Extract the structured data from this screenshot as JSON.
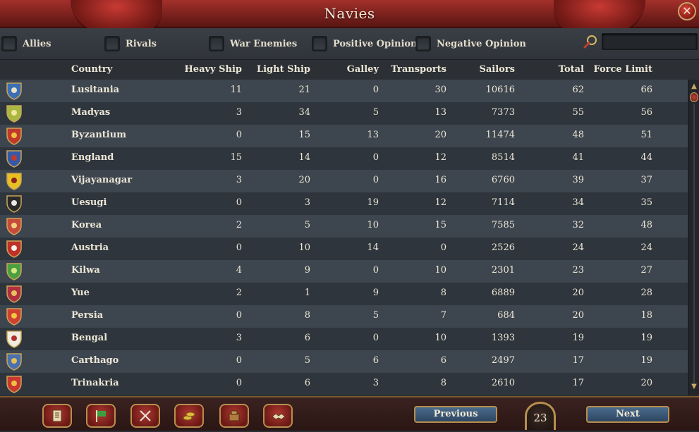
{
  "window": {
    "title": "Navies",
    "close_icon": "close-icon"
  },
  "filters": [
    {
      "label": "Allies",
      "checked": false
    },
    {
      "label": "Rivals",
      "checked": false
    },
    {
      "label": "War Enemies",
      "checked": false
    },
    {
      "label": "Positive Opinion",
      "checked": false
    },
    {
      "label": "Negative Opinion",
      "checked": false
    }
  ],
  "search": {
    "icon": "magnifier-icon",
    "value": ""
  },
  "columns": [
    "Country",
    "Heavy Ship",
    "Light Ship",
    "Galley",
    "Transports",
    "Sailors",
    "Total",
    "Force Limit"
  ],
  "rows": [
    {
      "country": "Lusitania",
      "heavy": "11",
      "light": "21",
      "galley": "0",
      "transports": "30",
      "sailors": "10616",
      "total": "62",
      "force_limit": "66",
      "shield_color": "#3a6fb5",
      "shield_accent": "#e8e0c8"
    },
    {
      "country": "Madyas",
      "heavy": "3",
      "light": "34",
      "galley": "5",
      "transports": "13",
      "sailors": "7373",
      "total": "55",
      "force_limit": "56",
      "shield_color": "#a8b840",
      "shield_accent": "#f2e6a0"
    },
    {
      "country": "Byzantium",
      "heavy": "0",
      "light": "15",
      "galley": "13",
      "transports": "20",
      "sailors": "11474",
      "total": "48",
      "force_limit": "51",
      "shield_color": "#c0392b",
      "shield_accent": "#f0c040"
    },
    {
      "country": "England",
      "heavy": "15",
      "light": "14",
      "galley": "0",
      "transports": "12",
      "sailors": "8514",
      "total": "41",
      "force_limit": "44",
      "shield_color": "#3559a8",
      "shield_accent": "#c0392b"
    },
    {
      "country": "Vijayanagar",
      "heavy": "3",
      "light": "20",
      "galley": "0",
      "transports": "16",
      "sailors": "6760",
      "total": "39",
      "force_limit": "37",
      "shield_color": "#e8c020",
      "shield_accent": "#8a2020"
    },
    {
      "country": "Uesugi",
      "heavy": "0",
      "light": "3",
      "galley": "19",
      "transports": "12",
      "sailors": "7114",
      "total": "34",
      "force_limit": "35",
      "shield_color": "#2a2a2a",
      "shield_accent": "#e8e8e8"
    },
    {
      "country": "Korea",
      "heavy": "2",
      "light": "5",
      "galley": "10",
      "transports": "15",
      "sailors": "7585",
      "total": "32",
      "force_limit": "48",
      "shield_color": "#c84a3a",
      "shield_accent": "#f0d080"
    },
    {
      "country": "Austria",
      "heavy": "0",
      "light": "10",
      "galley": "14",
      "transports": "0",
      "sailors": "2526",
      "total": "24",
      "force_limit": "24",
      "shield_color": "#c0302a",
      "shield_accent": "#f4f0e8"
    },
    {
      "country": "Kilwa",
      "heavy": "4",
      "light": "9",
      "galley": "0",
      "transports": "10",
      "sailors": "2301",
      "total": "23",
      "force_limit": "27",
      "shield_color": "#4aa040",
      "shield_accent": "#d8e880"
    },
    {
      "country": "Yue",
      "heavy": "2",
      "light": "1",
      "galley": "9",
      "transports": "8",
      "sailors": "6889",
      "total": "20",
      "force_limit": "28",
      "shield_color": "#b03040",
      "shield_accent": "#e8c060"
    },
    {
      "country": "Persia",
      "heavy": "0",
      "light": "8",
      "galley": "5",
      "transports": "7",
      "sailors": "684",
      "total": "20",
      "force_limit": "18",
      "shield_color": "#d04030",
      "shield_accent": "#f0c840"
    },
    {
      "country": "Bengal",
      "heavy": "3",
      "light": "6",
      "galley": "0",
      "transports": "10",
      "sailors": "1393",
      "total": "19",
      "force_limit": "19",
      "shield_color": "#f0ece0",
      "shield_accent": "#b03030"
    },
    {
      "country": "Carthago",
      "heavy": "0",
      "light": "5",
      "galley": "6",
      "transports": "6",
      "sailors": "2497",
      "total": "17",
      "force_limit": "19",
      "shield_color": "#4a70b0",
      "shield_accent": "#e8c050"
    },
    {
      "country": "Trinakria",
      "heavy": "0",
      "light": "6",
      "galley": "3",
      "transports": "8",
      "sailors": "2610",
      "total": "17",
      "force_limit": "20",
      "shield_color": "#c83830",
      "shield_accent": "#f0c040"
    }
  ],
  "bottom_nav": [
    {
      "icon": "ledger-icon"
    },
    {
      "icon": "flag-icon"
    },
    {
      "icon": "crossed-swords-icon"
    },
    {
      "icon": "coins-icon"
    },
    {
      "icon": "trade-goods-icon"
    },
    {
      "icon": "handshake-icon"
    }
  ],
  "pagination": {
    "previous_label": "Previous",
    "next_label": "Next",
    "page": "23"
  },
  "colors": {
    "title_red": "#8c2420",
    "row_dark": "#2e353c",
    "row_light": "#3d454e",
    "gold_border": "#b68f4f"
  }
}
